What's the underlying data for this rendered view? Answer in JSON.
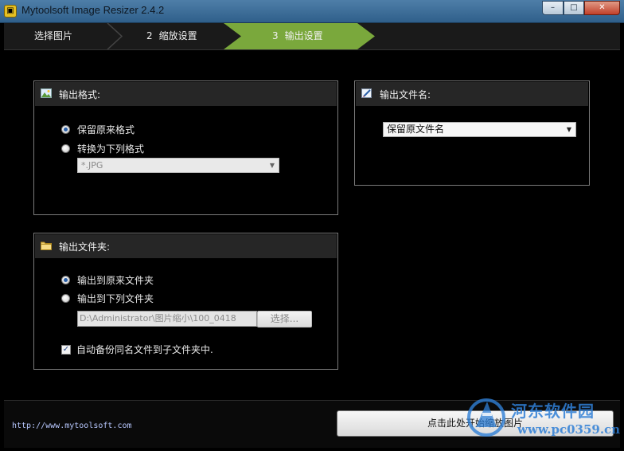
{
  "window": {
    "title": "Mytoolsoft Image Resizer 2.4.2",
    "controls": {
      "minimize": "–",
      "maximize": "□",
      "close": "✕"
    }
  },
  "wizard": {
    "steps": [
      {
        "num": "",
        "label": "选择图片"
      },
      {
        "num": "2",
        "label": "缩放设置"
      },
      {
        "num": "3",
        "label": "输出设置"
      }
    ],
    "active_step": 3,
    "accent_color": "#7aa83c"
  },
  "output_format": {
    "title": "输出格式:",
    "icon": "image-icon",
    "option_keep": "保留原来格式",
    "option_convert": "转换为下列格式",
    "selected": "keep",
    "format_select": "*.JPG"
  },
  "output_filename": {
    "title": "输出文件名:",
    "icon": "rename-icon",
    "select_value": "保留原文件名"
  },
  "output_folder": {
    "title": "输出文件夹:",
    "icon": "folder-icon",
    "option_original": "输出到原来文件夹",
    "option_below": "输出到下列文件夹",
    "selected": "original",
    "path": "D:\\Administrator\\图片缩小\\100_0418",
    "choose_button": "选择...",
    "backup_checkbox": "自动备份同名文件到子文件夹中.",
    "backup_checked": true
  },
  "footer": {
    "url": "http://www.mytoolsoft.com",
    "start_button": "点击此处开始缩放图片"
  },
  "watermark": {
    "name": "河东软件园",
    "url": "www.pc0359.cn"
  }
}
